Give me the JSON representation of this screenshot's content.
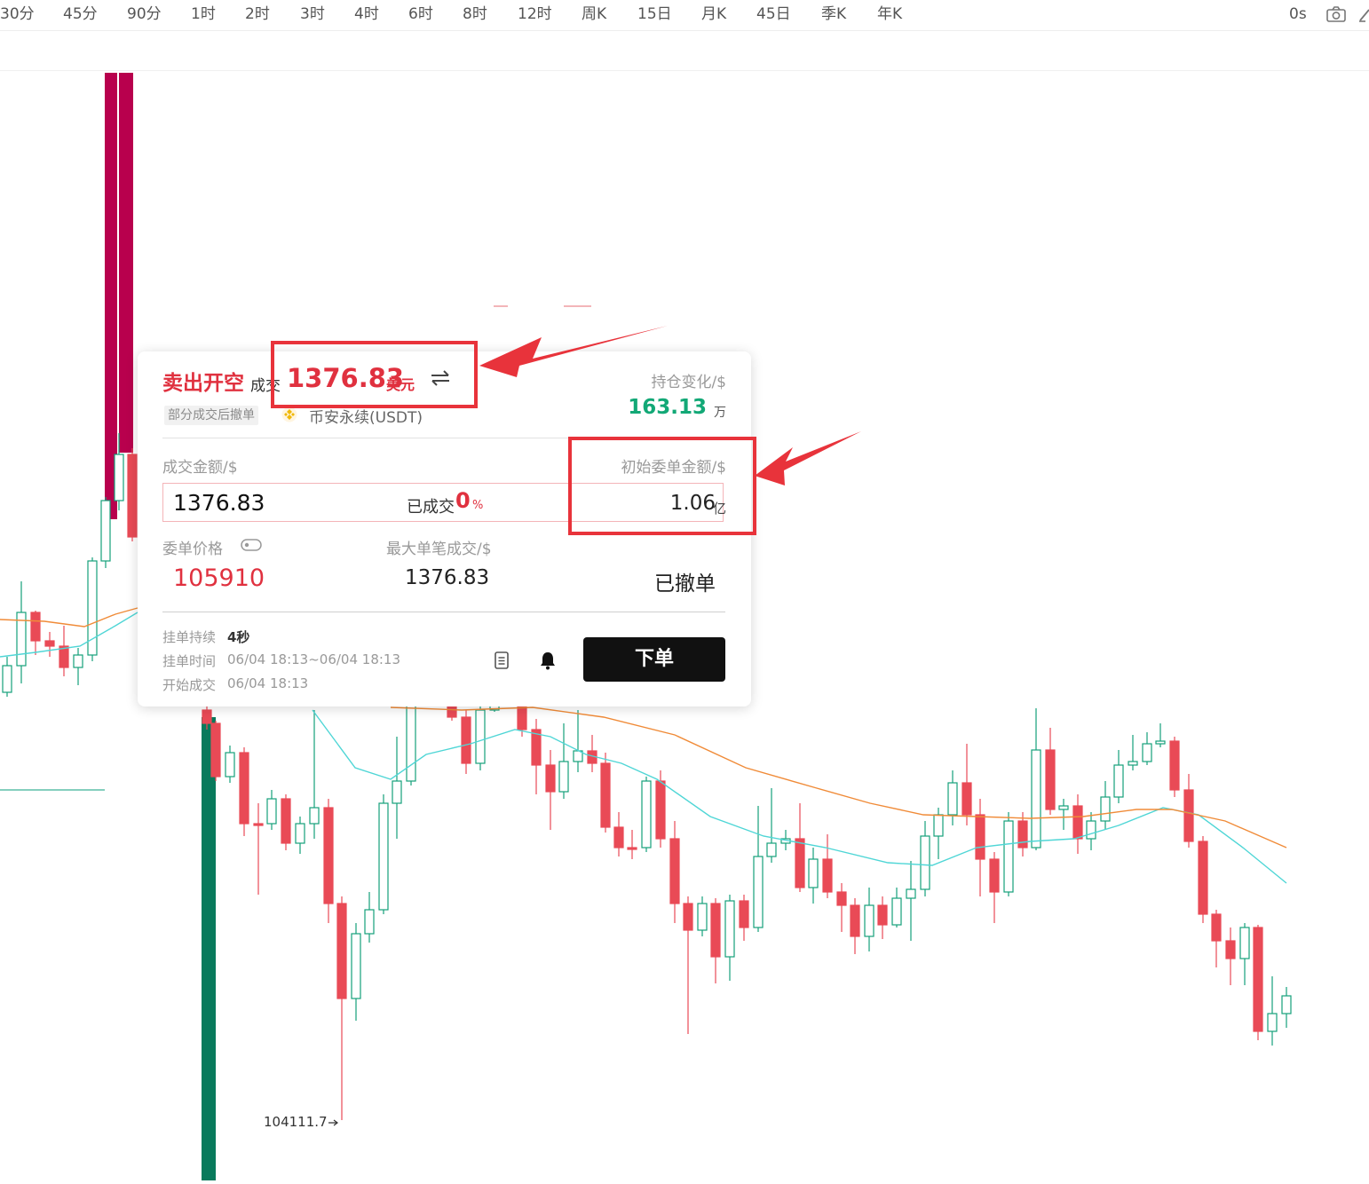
{
  "toolbar": {
    "intervals": [
      "30分",
      "45分",
      "90分",
      "1时",
      "2时",
      "3时",
      "4时",
      "6时",
      "8时",
      "12时",
      "周K",
      "15日",
      "月K",
      "45日",
      "季K",
      "年K"
    ],
    "countdown": "0s",
    "icons": [
      "camera-icon",
      "draw-icon"
    ]
  },
  "chart": {
    "low_marker": "104111.7",
    "colors": {
      "up": "#14a07a",
      "down": "#e94a56",
      "ma_fast": "#4fd6d6",
      "ma_slow": "#f08b38",
      "volume_spike": "#b8004d",
      "volume_green": "#097a5c"
    }
  },
  "order": {
    "side_label": "卖出开空",
    "deal_word": "成交",
    "deal_price": "1376.83",
    "deal_unit": "美元",
    "swap_icon": "swap-icon",
    "status_chip": "部分成交后撤单",
    "market": "币安永续(USDT)",
    "position_change_label": "持仓变化/$",
    "position_change_value": "163.13",
    "position_change_unit": "万",
    "filled_amount_label": "成交金额/$",
    "filled_amount_value": "1376.83",
    "filled_word": "已成交",
    "filled_percent": "0",
    "percent_sign": "%",
    "initial_amount_label": "初始委单金额/$",
    "initial_amount_value": "1.06",
    "initial_amount_unit": "亿",
    "order_price_label": "委单价格",
    "order_price_value": "105910",
    "max_fill_label": "最大单笔成交/$",
    "max_fill_value": "1376.83",
    "status": "已撤单",
    "duration_label": "挂单持续",
    "duration_value": "4秒",
    "time_label": "挂单时间",
    "time_value": "06/04 18:13~06/04 18:13",
    "start_label": "开始成交",
    "start_value": "06/04 18:13",
    "place_order_label": "下单"
  }
}
